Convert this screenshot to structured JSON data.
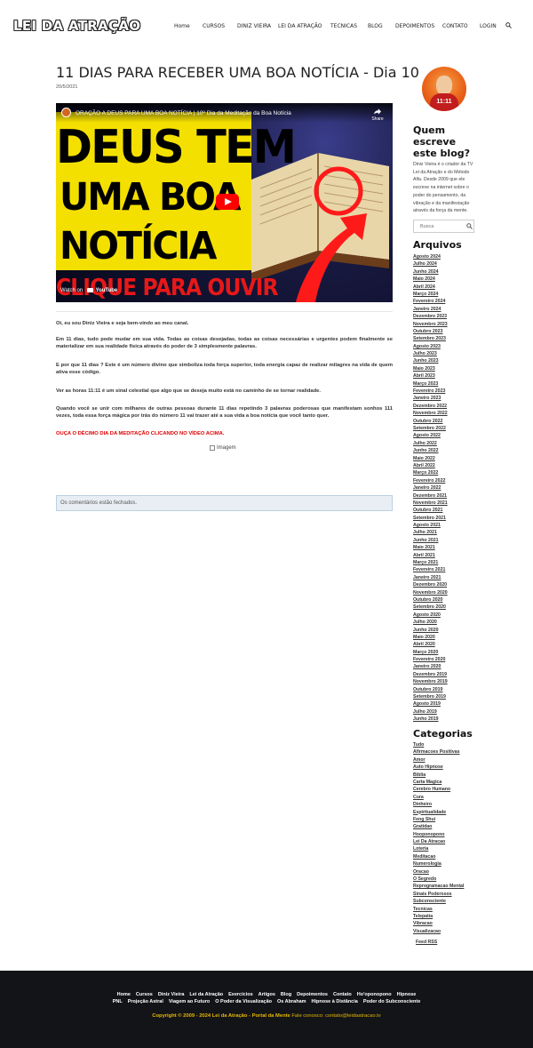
{
  "header": {
    "logo": "LEI DA ATRAÇÃO",
    "nav": [
      "Home",
      "CURSOS",
      "DINIZ VIEIRA",
      "LEI DA ATRAÇÃO",
      "TECNICAS",
      "BLOG",
      "DEPOIMENTOS",
      "CONTATO",
      "LOGIN"
    ],
    "search_icon": "search-icon"
  },
  "post": {
    "title": "11 DIAS PARA RECEBER UMA BOA NOTÍCIA - Dia 10",
    "date": "20/5/2021",
    "video": {
      "caption": "ORAÇÃO A DEUS PARA UMA BOA NOTÍCIA | 10º Dia da Meditação da Boa Notícia",
      "share_label": "Share",
      "thumb_lines": [
        "DEUS TEM",
        "UMA BOA",
        "NOTÍCIA"
      ],
      "thumb_red": "CLIQUE PARA OUVIR",
      "watch_on": "Watch on",
      "youtube": "YouTube"
    },
    "paragraphs": [
      "Oi, eu sou Diniz Vieira e seja bem-vindo ao meu canal.",
      "Em 11 dias, tudo pode mudar em sua vida. Todas as coisas desejadas, todas as coisas necessárias e urgentes podem finalmente se materializar em sua realidade física através do poder de 3 simplesmente palavras.",
      "E por que 11 dias ? Este é um número divino que simboliza toda força superior, toda energia capaz de realizar milagres na vida de quem ativa esse código.",
      "Ver as horas 11:11 é um sinal celestial que algo que se deseja muito está no caminho de se tornar realidade.",
      "Quando você se unir com milhares de outras pessoas durante 11 dias repetindo 3 palavras poderosas que manifestam sonhos 111 vezes, toda essa força mágica por trás do número 11 vai trazer até a sua vida a boa notícia que você tanto quer."
    ],
    "red_line": "OUÇA O DÉCIMO DIA DA MEDITAÇÃO CLICANDO NO VÍDEO ACIMA.",
    "image_alt": "Imagem",
    "comments_closed": "Os comentários estão fechados."
  },
  "sidebar": {
    "author_shirt": "11:11",
    "about_title": "Quem escreve este blog?",
    "about_text": "Diniz Vieira é o criador da TV Lei da Atração e do Método Alfa. Desde 2009 que ele escreve na internet sobre o poder do pensamento, da vibração e da manifestação através da força da mente.",
    "search_placeholder": "Busca",
    "archives_title": "Arquivos",
    "archives": [
      "Agosto 2024",
      "Julho 2024",
      "Junho 2024",
      "Maio 2024",
      "Abril 2024",
      "Março 2024",
      "Fevereiro 2024",
      "Janeiro 2024",
      "Dezembro 2023",
      "Novembro 2023",
      "Outubro 2023",
      "Setembro 2023",
      "Agosto 2023",
      "Julho 2023",
      "Junho 2023",
      "Maio 2023",
      "Abril 2023",
      "Março 2023",
      "Fevereiro 2023",
      "Janeiro 2023",
      "Dezembro 2022",
      "Novembro 2022",
      "Outubro 2022",
      "Setembro 2022",
      "Agosto 2022",
      "Julho 2022",
      "Junho 2022",
      "Maio 2022",
      "Abril 2022",
      "Março 2022",
      "Fevereiro 2022",
      "Janeiro 2022",
      "Dezembro 2021",
      "Novembro 2021",
      "Outubro 2021",
      "Setembro 2021",
      "Agosto 2021",
      "Julho 2021",
      "Junho 2021",
      "Maio 2021",
      "Abril 2021",
      "Março 2021",
      "Fevereiro 2021",
      "Janeiro 2021",
      "Dezembro 2020",
      "Novembro 2020",
      "Outubro 2020",
      "Setembro 2020",
      "Agosto 2020",
      "Julho 2020",
      "Junho 2020",
      "Maio 2020",
      "Abril 2020",
      "Março 2020",
      "Fevereiro 2020",
      "Janeiro 2020",
      "Dezembro 2019",
      "Novembro 2019",
      "Outubro 2019",
      "Setembro 2019",
      "Agosto 2019",
      "Julho 2019",
      "Junho 2019"
    ],
    "categories_title": "Categorias",
    "categories": [
      "Tudo",
      "Afirmacoes Positivas",
      "Amor",
      "Auto Hipnose",
      "Biblia",
      "Carta Magica",
      "Cerebro Humano",
      "Cura",
      "Dinheiro",
      "Espiritualidade",
      "Feng Shui",
      "Gratidao",
      "Hooponopono",
      "Lei Da Atracao",
      "Loteria",
      "Meditacao",
      "Numerologia",
      "Oracao",
      "O Segredo",
      "Reprogramacao Mental",
      "Sinais Poderosos",
      "Subconsciente",
      "Tecnicas",
      "Telepatia",
      "Vibracao",
      "Visualizacao"
    ],
    "feed": "Feed RSS"
  },
  "footer": {
    "row1": [
      "Home",
      "Cursos",
      "Diniz Vieira",
      "Lei da Atração",
      "Exercícios",
      "Artigos",
      "Blog",
      "Depoimentos",
      "Contato",
      "Ho'oponopono",
      "Hipnose"
    ],
    "row2": [
      "PNL",
      "Projeção Astral",
      "Viagem ao Futuro",
      "O Poder da Visualização",
      "Os Abraham",
      "Hipnose à Distância",
      "Poder do Subconsciente"
    ],
    "copyright": "Copyright © 2009 - 2024 Lei da Atração - Portal da Mente",
    "contact": "Fale conosco: contato@leidaatracao.tv"
  }
}
